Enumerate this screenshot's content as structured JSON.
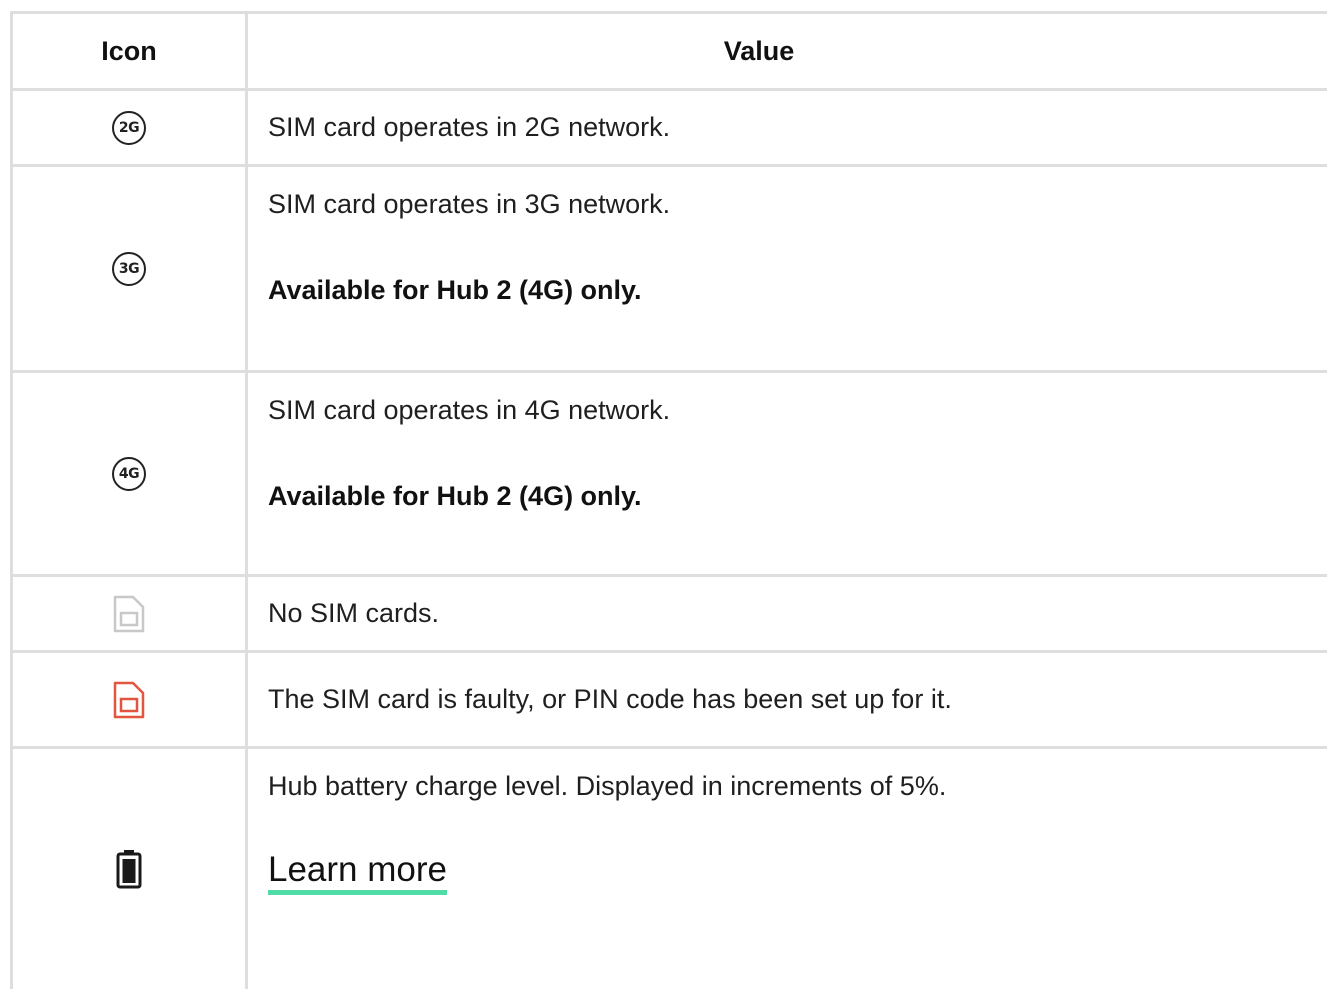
{
  "header": {
    "icon_col": "Icon",
    "value_col": "Value"
  },
  "rows": [
    {
      "icon": "2g-icon",
      "icon_text": "2G",
      "text": "SIM card operates in 2G network."
    },
    {
      "icon": "3g-icon",
      "icon_text": "3G",
      "text": "SIM card operates in 3G network.",
      "note": "Available for Hub 2 (4G) only."
    },
    {
      "icon": "4g-icon",
      "icon_text": "4G",
      "text": "SIM card operates in 4G network.",
      "note": "Available for Hub 2 (4G) only."
    },
    {
      "icon": "no-sim-icon",
      "text": "No SIM cards."
    },
    {
      "icon": "faulty-sim-icon",
      "text": "The SIM card is faulty, or PIN code has been set up for it."
    },
    {
      "icon": "battery-icon",
      "text": "Hub battery charge level. Displayed in increments of 5%.",
      "link": "Learn more"
    }
  ],
  "colors": {
    "border": "#dedede",
    "no_sim": "#c8c8c8",
    "faulty_sim": "#e2553f",
    "link_underline": "#4fdca7"
  }
}
